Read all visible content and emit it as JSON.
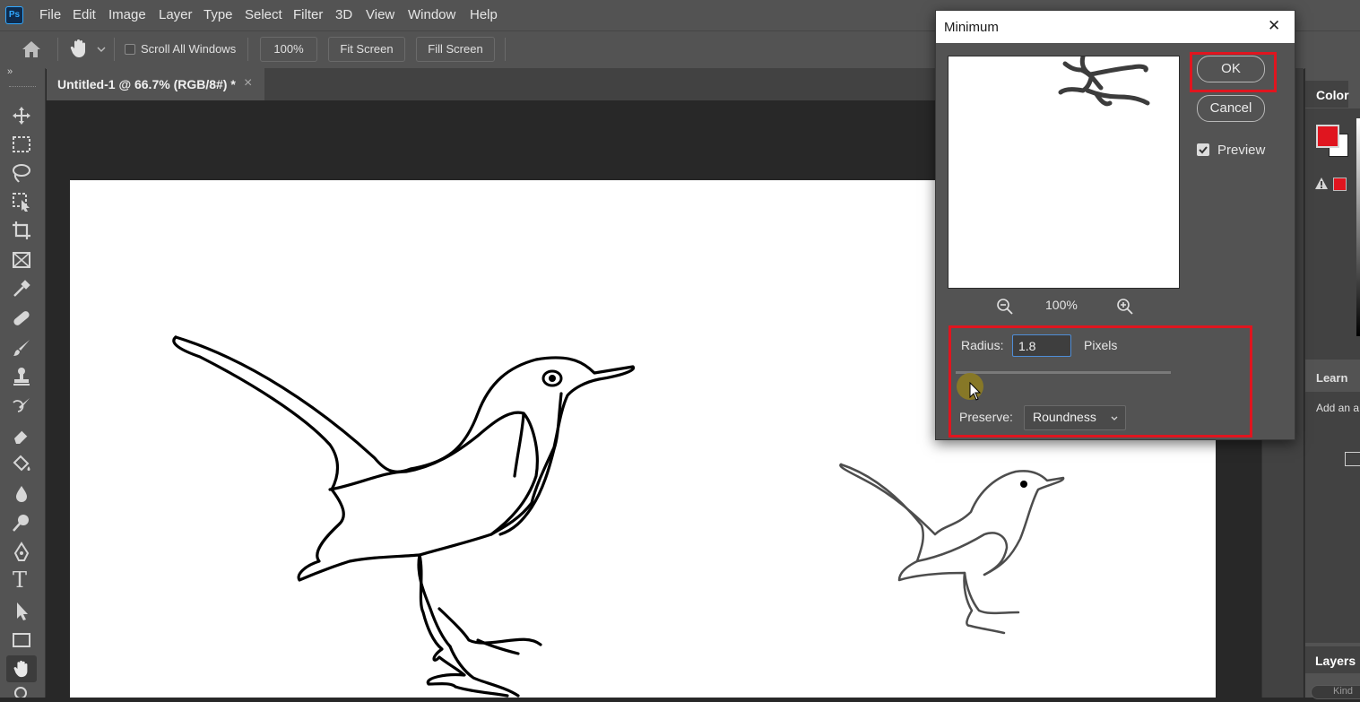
{
  "app": {
    "logo": "Ps"
  },
  "menu": [
    "File",
    "Edit",
    "Image",
    "Layer",
    "Type",
    "Select",
    "Filter",
    "3D",
    "View",
    "Window",
    "Help"
  ],
  "options": {
    "scroll_all_windows": "Scroll All Windows",
    "zoom": "100%",
    "fit_screen": "Fit Screen",
    "fill_screen": "Fill Screen",
    "collapse": "»"
  },
  "document_tab": {
    "title": "Untitled-1 @ 66.7% (RGB/8#) *",
    "close": "×"
  },
  "panels": {
    "color": "Color",
    "learn": "Learn",
    "learn_text": "Add an a",
    "layers": "Layers",
    "layers_search": "Kind"
  },
  "colors": {
    "foreground": "#e0151f",
    "background": "#ffffff",
    "highlight": "#e0151f"
  },
  "dialog": {
    "title": "Minimum",
    "close": "✕",
    "ok": "OK",
    "cancel": "Cancel",
    "preview_label": "Preview",
    "preview_checked": true,
    "zoom_level": "100%",
    "radius_label": "Radius:",
    "radius_value": "1.8",
    "radius_unit": "Pixels",
    "preserve_label": "Preserve:",
    "preserve_value": "Roundness"
  },
  "icons": {
    "home": "home-icon",
    "hand": "hand-icon",
    "chevron": "chevron-down-icon",
    "zoom_out": "zoom-out-icon",
    "zoom_in": "zoom-in-icon",
    "warning": "warning-icon"
  }
}
